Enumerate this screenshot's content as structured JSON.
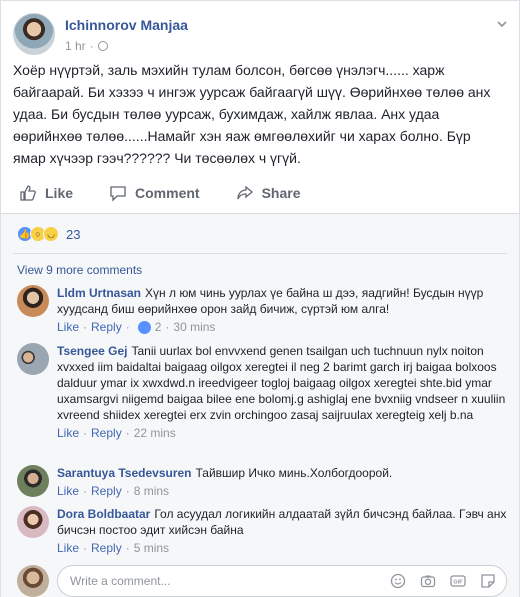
{
  "post": {
    "author": "Ichinnorov Manjaa",
    "time": "1 hr",
    "text": "Хоёр нүүртэй, заль мэхийн тулам болсон, бөгсөө үнэлэгч...... харж байгаарай. Би хэзээ ч ингэж уурсаж байгаагүй шүү. Өөрийнхөө төлөө анх удаа. Би бусдын төлөө уурсаж, бухимдаж, хайлж явлаа. Анх удаа өөрийнхөө төлөө......Намайг хэн яаж өмгөөлөхийг чи харах болно. Бүр ямар хүчээр гээч?????? Чи төсөөлөх ч үгүй.",
    "actions": {
      "like": "Like",
      "comment": "Comment",
      "share": "Share"
    },
    "reaction_count": "23"
  },
  "view_more": "View 9 more comments",
  "comments": [
    {
      "name": "Lldm Urtnasan",
      "text": "Хүн л юм чинь уурлах үе байна ш дээ, яадгийн! Бусдын нүүр хуудсанд биш өөрийнхөө орон зайд бичиж, сүртэй юм алга!",
      "like": "Like",
      "reply": "Reply",
      "likes": "2",
      "time": "30 mins"
    },
    {
      "name": "Tsengee Gej",
      "text": "Tanii uurlax bol envvxend genen tsailgan uch tuchnuun nylx noiton xvxxed iim baidaltai baigaag oilgox xeregtei il neg 2 barimt garch irj baigaa bolxoos dalduur ymar ix xwxdwd.n ireedvigeer togloj baigaag oilgox xeregtei shte.bid ymar uxamsargvi niigemd baigaa bilee ene bolomj.g ashiglaj ene bvxniig vndseer n xuuliin xvreend shiidex xeregtei erx zvin orchingoo zasaj saijruulax xeregteig xelj b.na",
      "like": "Like",
      "reply": "Reply",
      "time": "22 mins"
    },
    {
      "name": "Sarantuya Tsedevsuren",
      "text": "Тайвшир Ичко минь.Холбогдоорой.",
      "like": "Like",
      "reply": "Reply",
      "time": "8 mins"
    },
    {
      "name": "Dora Boldbaatar",
      "text": "Гол асуудал логикийн алдаатай зүйл бичсэнд байлаа. Гэвч анх бичсэн постоо эдит хийсэн байна",
      "like": "Like",
      "reply": "Reply",
      "time": "5 mins"
    }
  ],
  "write_placeholder": "Write a comment...",
  "colors": {
    "link": "#365899",
    "action_link": "#4267b2",
    "muted": "#90949c",
    "like_blue": "#5890ff"
  }
}
